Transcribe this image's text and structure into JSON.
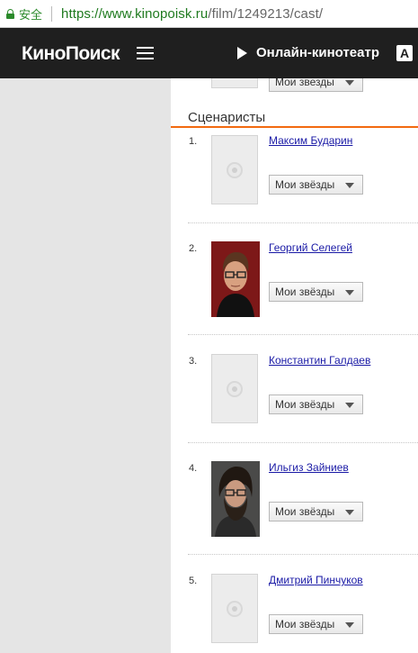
{
  "browser": {
    "secure_label": "安全",
    "url_host": "https://www.kinopoisk.ru",
    "url_path": "/film/1249213/cast/"
  },
  "header": {
    "logo": "КиноПоиск",
    "online_label": "Онлайн-кинотеатр",
    "a_badge": "A"
  },
  "top_partial": {
    "stars_label": "Мои звезды"
  },
  "section": {
    "title": "Сценаристы"
  },
  "writers": [
    {
      "num": "1.",
      "name": "Максим Бударин",
      "stars_label": "Мои звёзды",
      "photo": "placeholder"
    },
    {
      "num": "2.",
      "name": "Георгий Селегей",
      "stars_label": "Мои звёзды",
      "photo": "portrait"
    },
    {
      "num": "3.",
      "name": "Константин Галдаев",
      "stars_label": "Мои звёзды",
      "photo": "placeholder"
    },
    {
      "num": "4.",
      "name": "Ильгиз Зайниев",
      "stars_label": "Мои звёзды",
      "photo": "portrait"
    },
    {
      "num": "5.",
      "name": "Дмитрий Пинчуков",
      "stars_label": "Мои звёзды",
      "photo": "placeholder"
    }
  ],
  "colors": {
    "accent": "#f26a10",
    "link": "#1a1aa6",
    "header_bg": "#1f1f1f"
  }
}
